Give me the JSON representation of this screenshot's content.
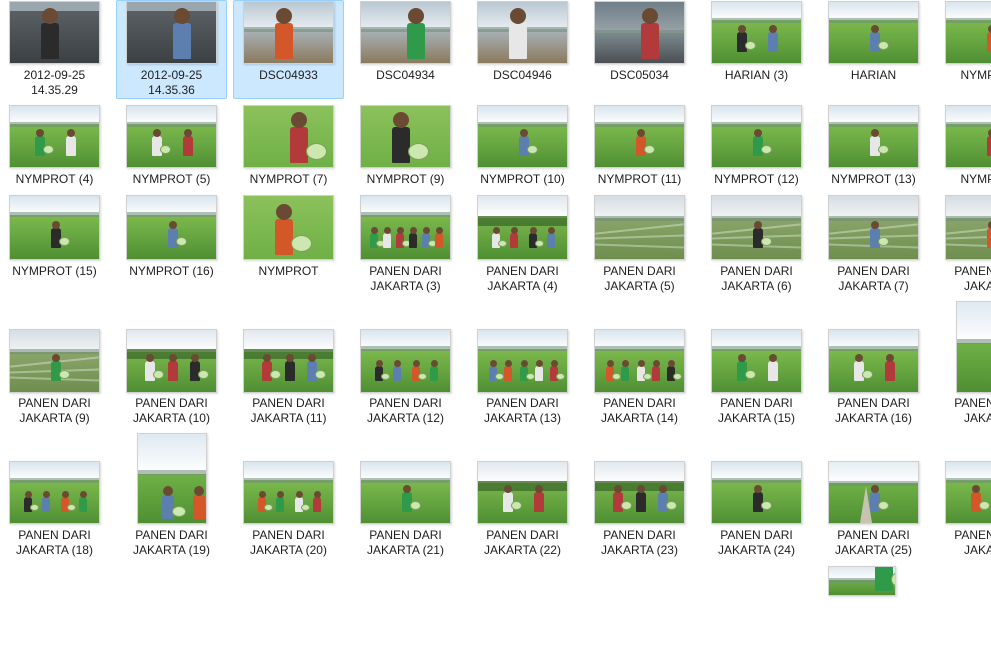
{
  "view": {
    "type": "file-explorer-thumbnail-view"
  },
  "scene_colors": {
    "sky_dark": "#6f7e89",
    "sky_light": "#dce8f2",
    "water": "#aab4ba",
    "field": "#6fb046",
    "field_dark": "#4f8f33",
    "path": "#c8c2b0",
    "selection_fill": "#cce8ff",
    "selection_border": "#99d1ff"
  },
  "files": [
    {
      "l1": "2012-09-25",
      "l2": "14.35.29",
      "scene": "water_dark",
      "people": 1
    },
    {
      "l1": "2012-09-25",
      "l2": "14.35.36",
      "scene": "water_dark",
      "people": 1,
      "selected": true
    },
    {
      "l1": "DSC04933",
      "l2": "",
      "scene": "lake",
      "people": 1,
      "selected": true
    },
    {
      "l1": "DSC04934",
      "l2": "",
      "scene": "lake",
      "people": 1
    },
    {
      "l1": "DSC04946",
      "l2": "",
      "scene": "lake",
      "people": 1
    },
    {
      "l1": "DSC05034",
      "l2": "",
      "scene": "lake_dusk",
      "people": 1
    },
    {
      "l1": "HARIAN (3)",
      "l2": "",
      "scene": "field",
      "people": 2
    },
    {
      "l1": "HARIAN",
      "l2": "",
      "scene": "field",
      "people": 1
    },
    {
      "l1": "NYMPROT",
      "l2": "",
      "scene": "field",
      "people": 1
    },
    {
      "l1": "NYMPROT (4)",
      "l2": "",
      "scene": "field",
      "people": 2
    },
    {
      "l1": "NYMPROT (5)",
      "l2": "",
      "scene": "field",
      "people": 2
    },
    {
      "l1": "NYMPROT (7)",
      "l2": "",
      "scene": "closeup",
      "people": 1
    },
    {
      "l1": "NYMPROT (9)",
      "l2": "",
      "scene": "closeup",
      "people": 1
    },
    {
      "l1": "NYMPROT (10)",
      "l2": "",
      "scene": "field",
      "people": 1
    },
    {
      "l1": "NYMPROT (11)",
      "l2": "",
      "scene": "field",
      "people": 1
    },
    {
      "l1": "NYMPROT (12)",
      "l2": "",
      "scene": "field",
      "people": 1
    },
    {
      "l1": "NYMPROT (13)",
      "l2": "",
      "scene": "field",
      "people": 1
    },
    {
      "l1": "NYMPROT",
      "l2": "",
      "scene": "field",
      "people": 1
    },
    {
      "l1": "NYMPROT (15)",
      "l2": "",
      "scene": "field",
      "people": 1
    },
    {
      "l1": "NYMPROT (16)",
      "l2": "",
      "scene": "field",
      "people": 1
    },
    {
      "l1": "NYMPROT",
      "l2": "",
      "scene": "closeup",
      "people": 1
    },
    {
      "l1": "PANEN DARI",
      "l2": "JAKARTA (3)",
      "scene": "group",
      "people": 6
    },
    {
      "l1": "PANEN DARI",
      "l2": "JAKARTA (4)",
      "scene": "trees",
      "people": 4
    },
    {
      "l1": "PANEN DARI",
      "l2": "JAKARTA (5)",
      "scene": "plowed",
      "people": 0
    },
    {
      "l1": "PANEN DARI",
      "l2": "JAKARTA (6)",
      "scene": "plowed",
      "people": 1
    },
    {
      "l1": "PANEN DARI",
      "l2": "JAKARTA (7)",
      "scene": "plowed",
      "people": 1
    },
    {
      "l1": "PANEN DARI",
      "l2": "JAKARTA",
      "scene": "plowed",
      "people": 1
    },
    {
      "l1": "PANEN DARI",
      "l2": "JAKARTA (9)",
      "scene": "plowed",
      "people": 1
    },
    {
      "l1": "PANEN DARI",
      "l2": "JAKARTA (10)",
      "scene": "trees",
      "people": 3
    },
    {
      "l1": "PANEN DARI",
      "l2": "JAKARTA (11)",
      "scene": "trees",
      "people": 3
    },
    {
      "l1": "PANEN DARI",
      "l2": "JAKARTA (12)",
      "scene": "group",
      "people": 4
    },
    {
      "l1": "PANEN DARI",
      "l2": "JAKARTA (13)",
      "scene": "field",
      "people": 5
    },
    {
      "l1": "PANEN DARI",
      "l2": "JAKARTA (14)",
      "scene": "field",
      "people": 5
    },
    {
      "l1": "PANEN DARI",
      "l2": "JAKARTA (15)",
      "scene": "field",
      "people": 2
    },
    {
      "l1": "PANEN DARI",
      "l2": "JAKARTA (16)",
      "scene": "field",
      "people": 2
    },
    {
      "l1": "PANEN DARI",
      "l2": "JAKARTA",
      "scene": "portrait",
      "people": 1
    },
    {
      "l1": "PANEN DARI",
      "l2": "JAKARTA (18)",
      "scene": "field",
      "people": 4
    },
    {
      "l1": "PANEN DARI",
      "l2": "JAKARTA (19)",
      "scene": "portrait",
      "people": 2
    },
    {
      "l1": "PANEN DARI",
      "l2": "JAKARTA (20)",
      "scene": "group",
      "people": 4
    },
    {
      "l1": "PANEN DARI",
      "l2": "JAKARTA (21)",
      "scene": "field",
      "people": 1
    },
    {
      "l1": "PANEN DARI",
      "l2": "JAKARTA (22)",
      "scene": "trees",
      "people": 2
    },
    {
      "l1": "PANEN DARI",
      "l2": "JAKARTA (23)",
      "scene": "trees",
      "people": 3
    },
    {
      "l1": "PANEN DARI",
      "l2": "JAKARTA (24)",
      "scene": "field",
      "people": 1
    },
    {
      "l1": "PANEN DARI",
      "l2": "JAKARTA (25)",
      "scene": "road",
      "people": 1
    },
    {
      "l1": "PANEN DARI",
      "l2": "JAKARTA",
      "scene": "field",
      "people": 2
    },
    {
      "l1": "",
      "l2": "",
      "scene": "portrait",
      "people": 1
    }
  ]
}
